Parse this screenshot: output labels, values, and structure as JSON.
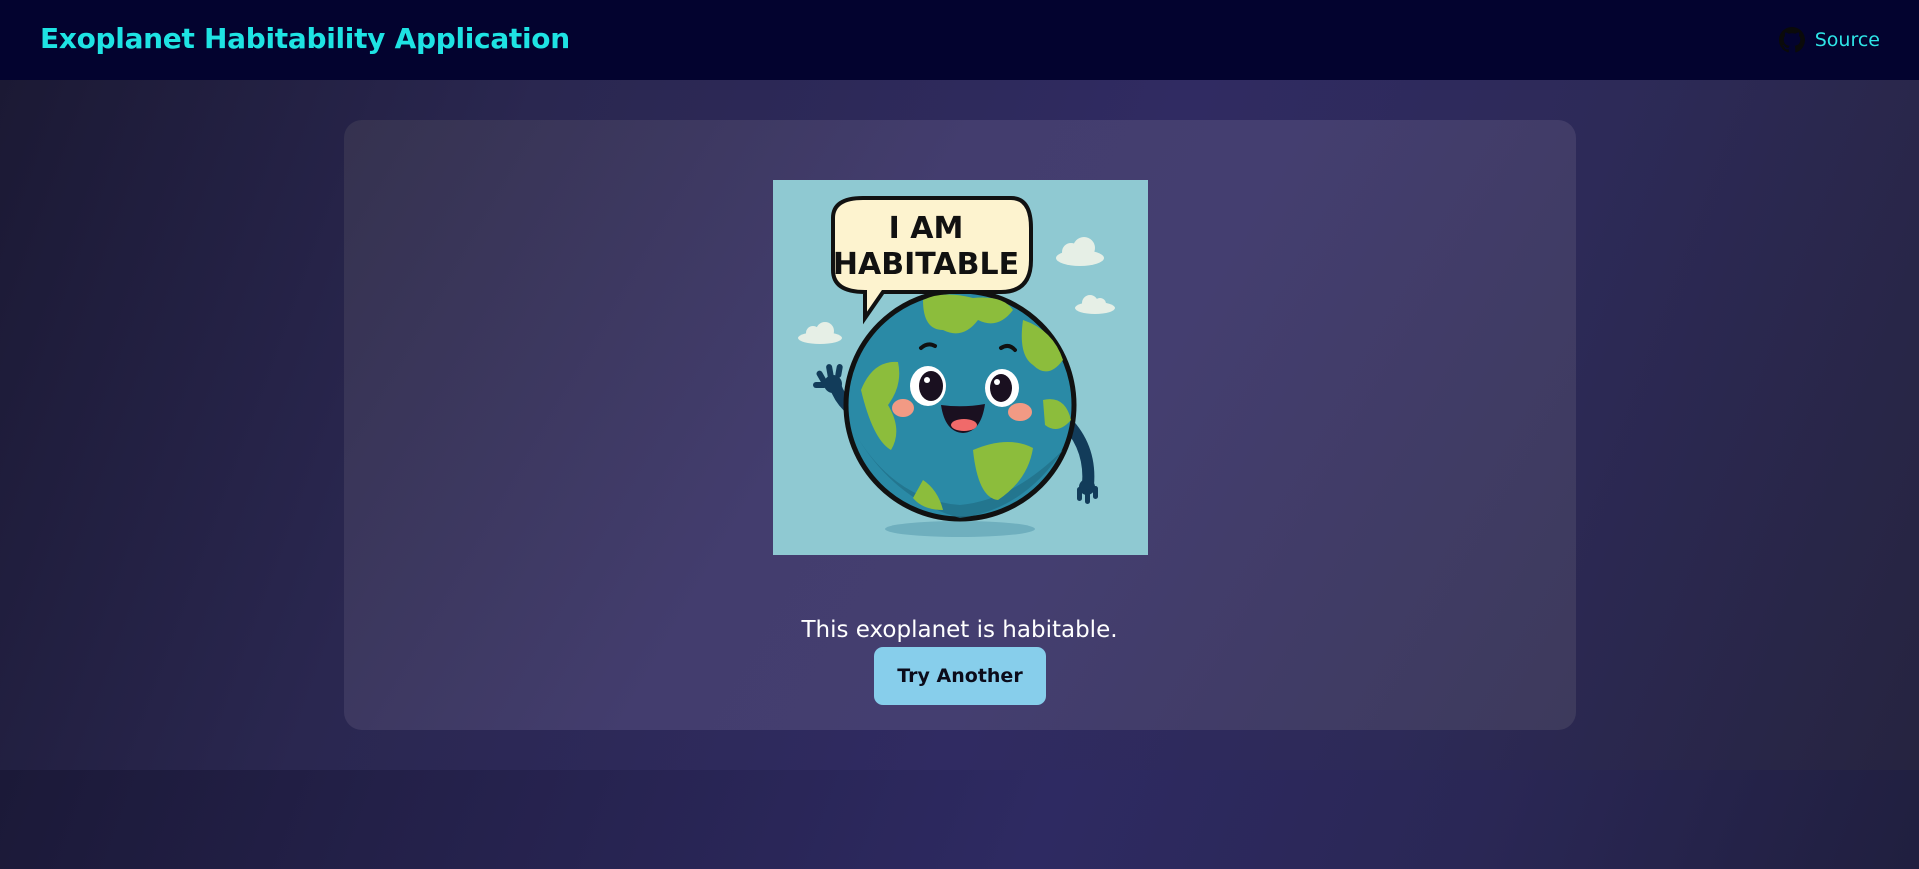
{
  "navbar": {
    "title": "Exoplanet Habitability Application",
    "source_label": "Source",
    "source_icon": "github-icon"
  },
  "result": {
    "image": {
      "speech_bubble_text_line1": "I AM",
      "speech_bubble_text_line2": "HABITABLE",
      "description_icon": "smiling-earth-illustration"
    },
    "message": "This exoplanet is habitable.",
    "button_label": "Try Another"
  },
  "colors": {
    "navbar_bg": "#03032f",
    "brand_text": "#1ee3e3",
    "button_bg": "#87ceeb",
    "image_bg": "#8fc9d2"
  }
}
